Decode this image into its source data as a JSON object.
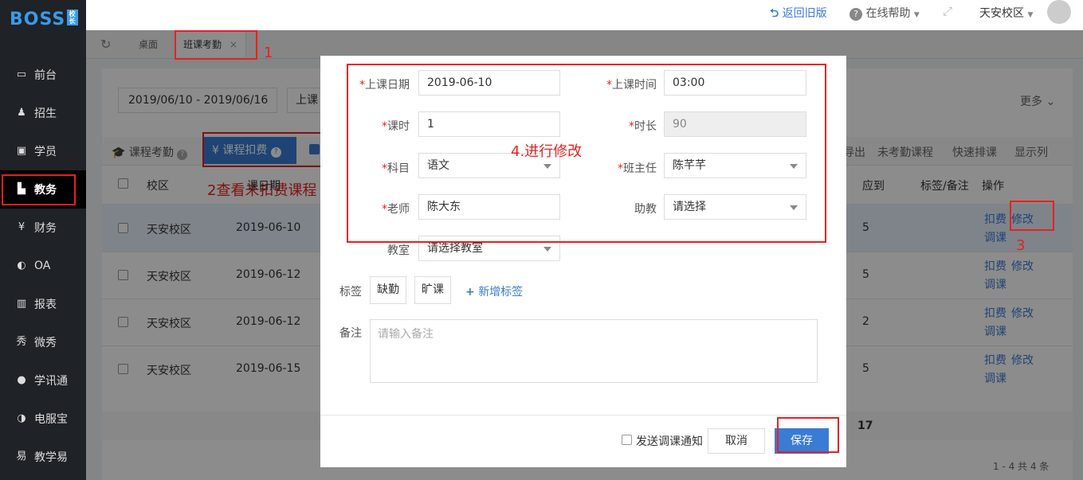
{
  "app": {
    "logo": "BOSS",
    "logo_badge": "校长"
  },
  "sidebar": {
    "items": [
      {
        "label": "前台",
        "icon": "calendar-icon"
      },
      {
        "label": "招生",
        "icon": "user-add-icon"
      },
      {
        "label": "学员",
        "icon": "id-card-icon"
      },
      {
        "label": "教务",
        "icon": "book-icon"
      },
      {
        "label": "财务",
        "icon": "yen-icon"
      },
      {
        "label": "OA",
        "icon": "toggle-icon"
      },
      {
        "label": "报表",
        "icon": "bar-chart-icon"
      },
      {
        "label": "微秀",
        "icon": "xiu-icon"
      },
      {
        "label": "学讯通",
        "icon": "pin-icon"
      },
      {
        "label": "电服宝",
        "icon": "phone-icon"
      },
      {
        "label": "教学易",
        "icon": "teach-icon"
      }
    ]
  },
  "topbar": {
    "back_old": "返回旧版",
    "help": "在线帮助",
    "campus": "天安校区"
  },
  "tabs": [
    {
      "label": "桌面"
    },
    {
      "label": "班课考勤",
      "close": "×"
    }
  ],
  "filters": {
    "date_range": "2019/06/10 - 2019/06/16",
    "course_select": "上课",
    "more": "更多"
  },
  "subtabs": {
    "attendance": "课程考勤",
    "deduct": "¥ 课程扣费"
  },
  "toolbar": {
    "export": "导出",
    "unchecked": "未考勤课程",
    "quick": "快速排课",
    "columns": "显示列"
  },
  "table": {
    "headers": {
      "campus": "校区",
      "date": "课日期",
      "should": "应到",
      "tags": "标签/备注",
      "ops": "操作"
    },
    "rows": [
      {
        "campus": "天安校区",
        "date": "2019-06-10",
        "should": "5"
      },
      {
        "campus": "天安校区",
        "date": "2019-06-12",
        "should": "5"
      },
      {
        "campus": "天安校区",
        "date": "2019-06-12",
        "should": "2"
      },
      {
        "campus": "天安校区",
        "date": "2019-06-15",
        "should": "5"
      }
    ],
    "op_deduct": "扣费",
    "op_edit": "修改",
    "op_adjust": "调课",
    "total": "17",
    "pagination": "1 - 4   共 4 条"
  },
  "form": {
    "date_label": "上课日期",
    "date_value": "2019-06-10",
    "time_label": "上课时间",
    "time_value": "03:00",
    "hours_label": "课时",
    "hours_value": "1",
    "duration_label": "时长",
    "duration_value": "90",
    "subject_label": "科目",
    "subject_value": "语文",
    "head_label": "班主任",
    "head_value": "陈芊芊",
    "teacher_label": "老师",
    "teacher_value": "陈大东",
    "assistant_label": "助教",
    "assistant_value": "请选择",
    "room_label": "教室",
    "room_value": "请选择教室",
    "tags_label": "标签",
    "tag1": "缺勤",
    "tag2": "旷课",
    "add_tag": "新增标签",
    "note_label": "备注",
    "note_placeholder": "请输入备注",
    "notify_label": "发送调课通知",
    "cancel": "取消",
    "save": "保存",
    "required_mark": "*"
  },
  "annotations": {
    "a1": "1",
    "a2": "2查看未扣费课程",
    "a3": "3",
    "a4": "4.进行修改"
  },
  "colors": {
    "accent": "#3a7bd5",
    "annotation": "#e8211e",
    "sidebar": "#1f2226"
  }
}
